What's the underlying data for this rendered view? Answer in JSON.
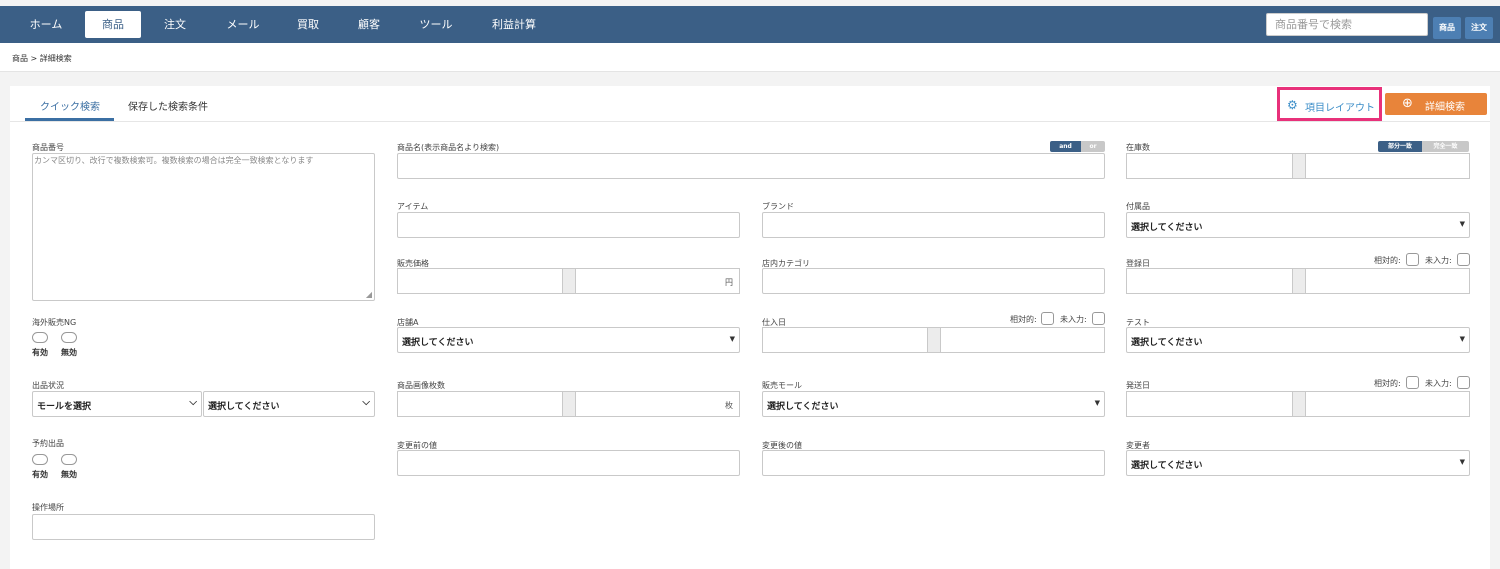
{
  "nav": {
    "items": [
      "ホーム",
      "商品",
      "注文",
      "メール",
      "買取",
      "顧客",
      "ツール",
      "利益計算"
    ],
    "active": "商品",
    "search_placeholder": "商品番号で検索",
    "btn_product": "商品",
    "btn_order": "注文"
  },
  "breadcrumb": "商品 > 詳細検索",
  "tabs": [
    "クイック検索",
    "保存した検索条件"
  ],
  "buttons": {
    "layout": "項目レイアウト",
    "advanced": "詳細検索"
  },
  "toggles": {
    "and": "and",
    "or": "or",
    "partial": "部分一致",
    "exact": "完全一致"
  },
  "fields": {
    "product_number": {
      "label": "商品番号",
      "placeholder": "カンマ区切り、改行で複数検索可。複数検索の場合は完全一致検索となります"
    },
    "product_name": "商品名(表示商品名より検索)",
    "stock": "在庫数",
    "item": "アイテム",
    "brand": "ブランド",
    "accessory": "付属品",
    "price": {
      "label": "販売価格",
      "unit": "円"
    },
    "store_category": "店内カテゴリ",
    "reg_date": "登録日",
    "overseas_ng": "海外販売NG",
    "store_a": "店舗A",
    "purchase_date": "仕入日",
    "test": "テスト",
    "listing_status": "出品状況",
    "image_count": {
      "label": "商品画像枚数",
      "unit": "枚"
    },
    "sales_mall": "販売モール",
    "ship_date": "発送日",
    "pre_order": "予約出品",
    "before_value": "変更前の値",
    "after_value": "変更後の値",
    "changer": "変更者",
    "operation_place": "操作場所"
  },
  "select_default": "選択してください",
  "select_mall": "モールを選択",
  "radio": {
    "yes": "有効",
    "no": "無効"
  },
  "relative": "相対的:",
  "unentered": "未入力:",
  "colors": {
    "nav": "#3b5f86",
    "accent_orange": "#e8843a",
    "highlight": "#e8317a",
    "link_blue": "#3c8ec8"
  }
}
